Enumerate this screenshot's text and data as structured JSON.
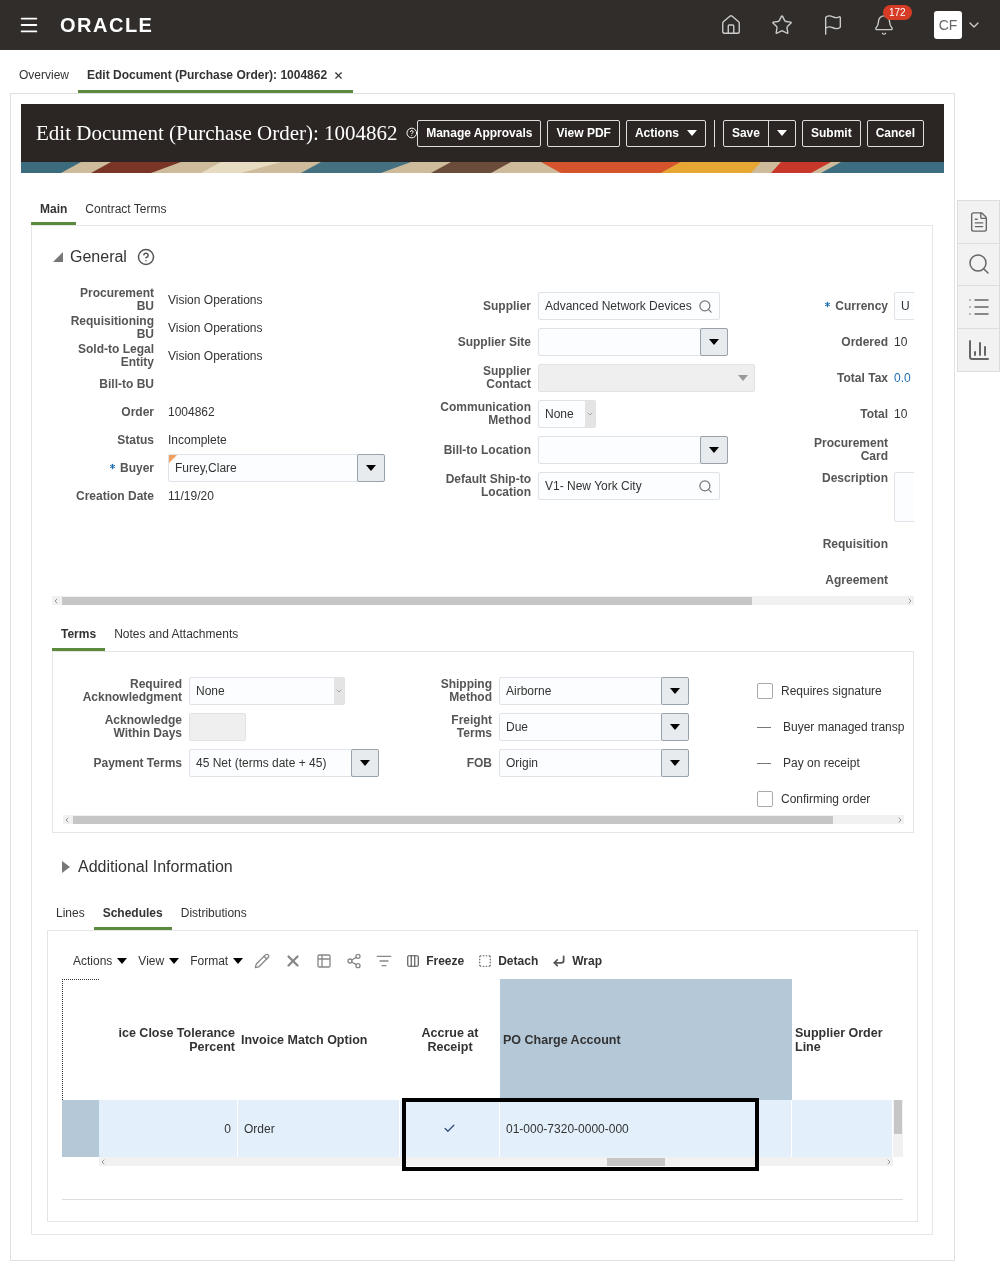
{
  "top_bar": {
    "logo": "ORACLE",
    "notification_count": "172",
    "avatar_initials": "CF"
  },
  "page_tabs": [
    {
      "label": "Overview",
      "selected": false,
      "closable": false
    },
    {
      "label": "Edit Document (Purchase Order): 1004862",
      "selected": true,
      "closable": true
    }
  ],
  "header": {
    "title": "Edit Document (Purchase Order): 1004862",
    "buttons": [
      {
        "label": "Manage Approvals",
        "kind": "button"
      },
      {
        "label": "View PDF",
        "kind": "button"
      },
      {
        "label": "Actions",
        "kind": "menu"
      },
      {
        "kind": "separator"
      },
      {
        "label": "Save",
        "kind": "split"
      },
      {
        "label": "Submit",
        "kind": "button"
      },
      {
        "label": "Cancel",
        "kind": "button"
      }
    ]
  },
  "section_tabs": [
    {
      "label": "Main",
      "selected": true
    },
    {
      "label": "Contract Terms",
      "selected": false
    }
  ],
  "general": {
    "title": "General",
    "expanded": true,
    "column_1": [
      {
        "label": "Procurement BU",
        "value": "Vision Operations",
        "kind": "text"
      },
      {
        "label": "Requisitioning BU",
        "value": "Vision Operations",
        "kind": "text"
      },
      {
        "label": "Sold-to Legal Entity",
        "value": "Vision Operations",
        "kind": "text"
      },
      {
        "label": "Bill-to BU",
        "kind": "text"
      },
      {
        "label": "Order",
        "value": "1004862",
        "kind": "text"
      },
      {
        "label": "Status",
        "value": "Incomplete",
        "kind": "text"
      },
      {
        "label": "Buyer",
        "value": "Furey,Clare",
        "kind": "select",
        "required": true,
        "changed": true
      },
      {
        "label": "Creation Date",
        "value": "11/19/20",
        "kind": "text"
      }
    ],
    "column_2": [
      {
        "label": "Supplier",
        "value": "Advanced Network Devices",
        "kind": "search"
      },
      {
        "label": "Supplier Site",
        "kind": "select"
      },
      {
        "label": "Supplier Contact",
        "kind": "disabled"
      },
      {
        "label": "Communication Method",
        "value": "None",
        "kind": "choice"
      },
      {
        "label": "Bill-to Location",
        "kind": "select"
      },
      {
        "label": "Default Ship-to Location",
        "value": "V1- New York City",
        "kind": "search"
      }
    ],
    "column_3": [
      {
        "label": "Currency",
        "value": "U",
        "kind": "field",
        "required": true
      },
      {
        "label": "Ordered",
        "value": "10",
        "kind": "text"
      },
      {
        "label": "Total Tax",
        "value": "0.0",
        "kind": "link"
      },
      {
        "label": "Total",
        "value": "10",
        "kind": "text"
      },
      {
        "label": "Procurement Card",
        "kind": "text"
      },
      {
        "label": "Description",
        "kind": "textarea"
      },
      {
        "label": "Requisition",
        "kind": "text"
      },
      {
        "label": "Agreement",
        "kind": "text"
      }
    ]
  },
  "terms_tabs": [
    {
      "label": "Terms",
      "selected": true
    },
    {
      "label": "Notes and Attachments",
      "selected": false
    }
  ],
  "terms": {
    "column_1": [
      {
        "label": "Required Acknowledgment",
        "value": "None",
        "kind": "choice"
      },
      {
        "label": "Acknowledge Within Days",
        "kind": "disabled"
      },
      {
        "label": "Payment Terms",
        "value": "45 Net (terms date + 45)",
        "kind": "select"
      }
    ],
    "column_2": [
      {
        "label": "Shipping Method",
        "value": "Airborne",
        "kind": "select"
      },
      {
        "label": "Freight Terms",
        "value": "Due",
        "kind": "select"
      },
      {
        "label": "FOB",
        "value": "Origin",
        "kind": "select"
      }
    ],
    "options": [
      {
        "label": "Requires signature",
        "kind": "checkbox",
        "checked": false
      },
      {
        "label": "Buyer managed transp",
        "kind": "readonly",
        "checked": false
      },
      {
        "label": "Pay on receipt",
        "kind": "readonly",
        "checked": false
      },
      {
        "label": "Confirming order",
        "kind": "checkbox",
        "checked": false
      }
    ]
  },
  "additional_information": {
    "title": "Additional Information",
    "expanded": false
  },
  "lines_tabs": [
    {
      "label": "Lines",
      "selected": false
    },
    {
      "label": "Schedules",
      "selected": true
    },
    {
      "label": "Distributions",
      "selected": false
    }
  ],
  "toolbar": {
    "menus": [
      "Actions",
      "View",
      "Format"
    ],
    "buttons": [
      {
        "label": "Freeze",
        "kind": "freeze"
      },
      {
        "label": "Detach",
        "kind": "detach"
      },
      {
        "label": "Wrap",
        "kind": "wrap"
      }
    ]
  },
  "table": {
    "columns": [
      {
        "label": "ice Close Tolerance Percent",
        "selected": false
      },
      {
        "label": "Invoice Match Option",
        "selected": false
      },
      {
        "label": "Accrue at Receipt",
        "selected": false
      },
      {
        "label": "PO Charge Account",
        "selected": true
      },
      {
        "label": "Supplier Order Line",
        "selected": false
      }
    ],
    "rows": [
      {
        "selected": true,
        "cells": [
          {
            "text": "0"
          },
          {
            "text": "Order"
          },
          {
            "checked": true
          },
          {
            "text": "01-000-7320-0000-000"
          }
        ]
      }
    ]
  }
}
